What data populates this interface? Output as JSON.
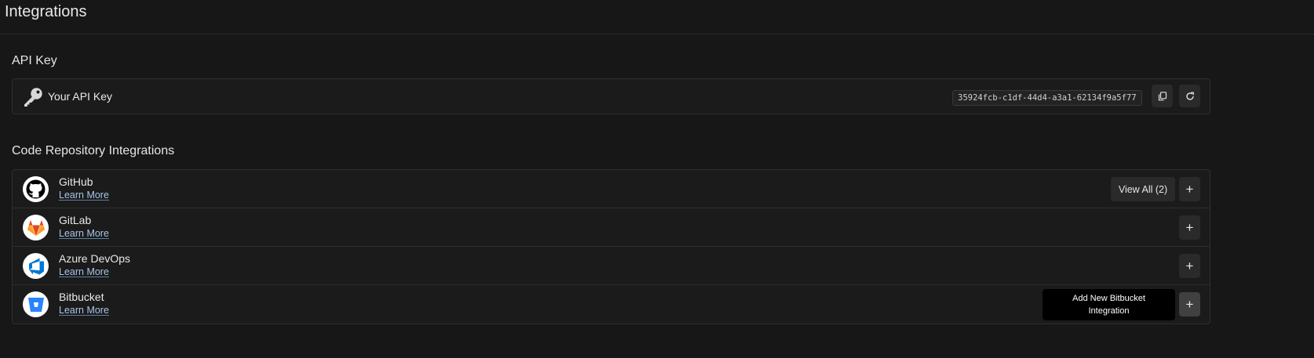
{
  "page": {
    "title": "Integrations"
  },
  "api_key_section": {
    "title": "API Key",
    "label": "Your API Key",
    "value": "35924fcb-c1df-44d4-a3a1-62134f9a5f77",
    "copy_icon": "copy-icon",
    "refresh_icon": "refresh-icon"
  },
  "repo_section": {
    "title": "Code Repository Integrations",
    "integrations": [
      {
        "name": "GitHub",
        "link": "Learn More",
        "icon": "github-icon",
        "view_all": "View All (2)"
      },
      {
        "name": "GitLab",
        "link": "Learn More",
        "icon": "gitlab-icon"
      },
      {
        "name": "Azure DevOps",
        "link": "Learn More",
        "icon": "azure-devops-icon"
      },
      {
        "name": "Bitbucket",
        "link": "Learn More",
        "icon": "bitbucket-icon"
      }
    ],
    "add_label": "+"
  },
  "tooltip": {
    "text": "Add New Bitbucket Integration"
  },
  "colors": {
    "background": "#171717",
    "card": "#1b1b1b",
    "border": "#2e2e2e",
    "link": "#a8c4e6",
    "github": "#000000",
    "gitlab": "#e24329",
    "azure": "#0078d4",
    "bitbucket": "#2684ff"
  }
}
